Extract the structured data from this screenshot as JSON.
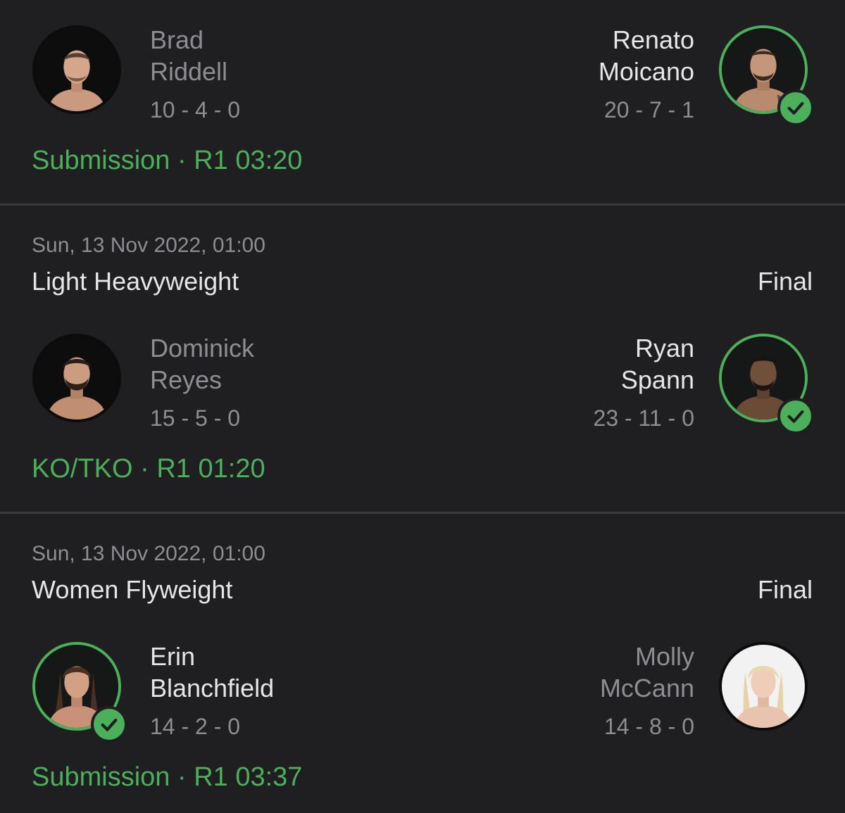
{
  "colors": {
    "background": "#1f1f21",
    "divider": "#3a3a3d",
    "winner_accent": "#4caf5a",
    "text_primary": "#e6e6e8",
    "text_secondary": "#8e8e92"
  },
  "fights": [
    {
      "date": "",
      "weight_class": "",
      "status": "",
      "fighter_left": {
        "first": "Brad",
        "last": "Riddell",
        "record": "10 - 4 - 0",
        "winner": false
      },
      "fighter_right": {
        "first": "Renato",
        "last": "Moicano",
        "record": "20 - 7 - 1",
        "winner": true
      },
      "result": {
        "method": "Submission",
        "separator": "·",
        "time": "R1 03:20"
      }
    },
    {
      "date": "Sun, 13 Nov 2022, 01:00",
      "weight_class": "Light Heavyweight",
      "status": "Final",
      "fighter_left": {
        "first": "Dominick",
        "last": "Reyes",
        "record": "15 - 5 - 0",
        "winner": false
      },
      "fighter_right": {
        "first": "Ryan",
        "last": "Spann",
        "record": "23 - 11 - 0",
        "winner": true
      },
      "result": {
        "method": "KO/TKO",
        "separator": "·",
        "time": "R1 01:20"
      }
    },
    {
      "date": "Sun, 13 Nov 2022, 01:00",
      "weight_class": "Women Flyweight",
      "status": "Final",
      "fighter_left": {
        "first": "Erin",
        "last": "Blanchfield",
        "record": "14 - 2 - 0",
        "winner": true
      },
      "fighter_right": {
        "first": "Molly",
        "last": "McCann",
        "record": "14 - 8 - 0",
        "winner": false
      },
      "result": {
        "method": "Submission",
        "separator": "·",
        "time": "R1 03:37"
      }
    }
  ],
  "icons": {
    "avatar": "fighter-headshot-icon",
    "winner": "checkmark-icon"
  }
}
